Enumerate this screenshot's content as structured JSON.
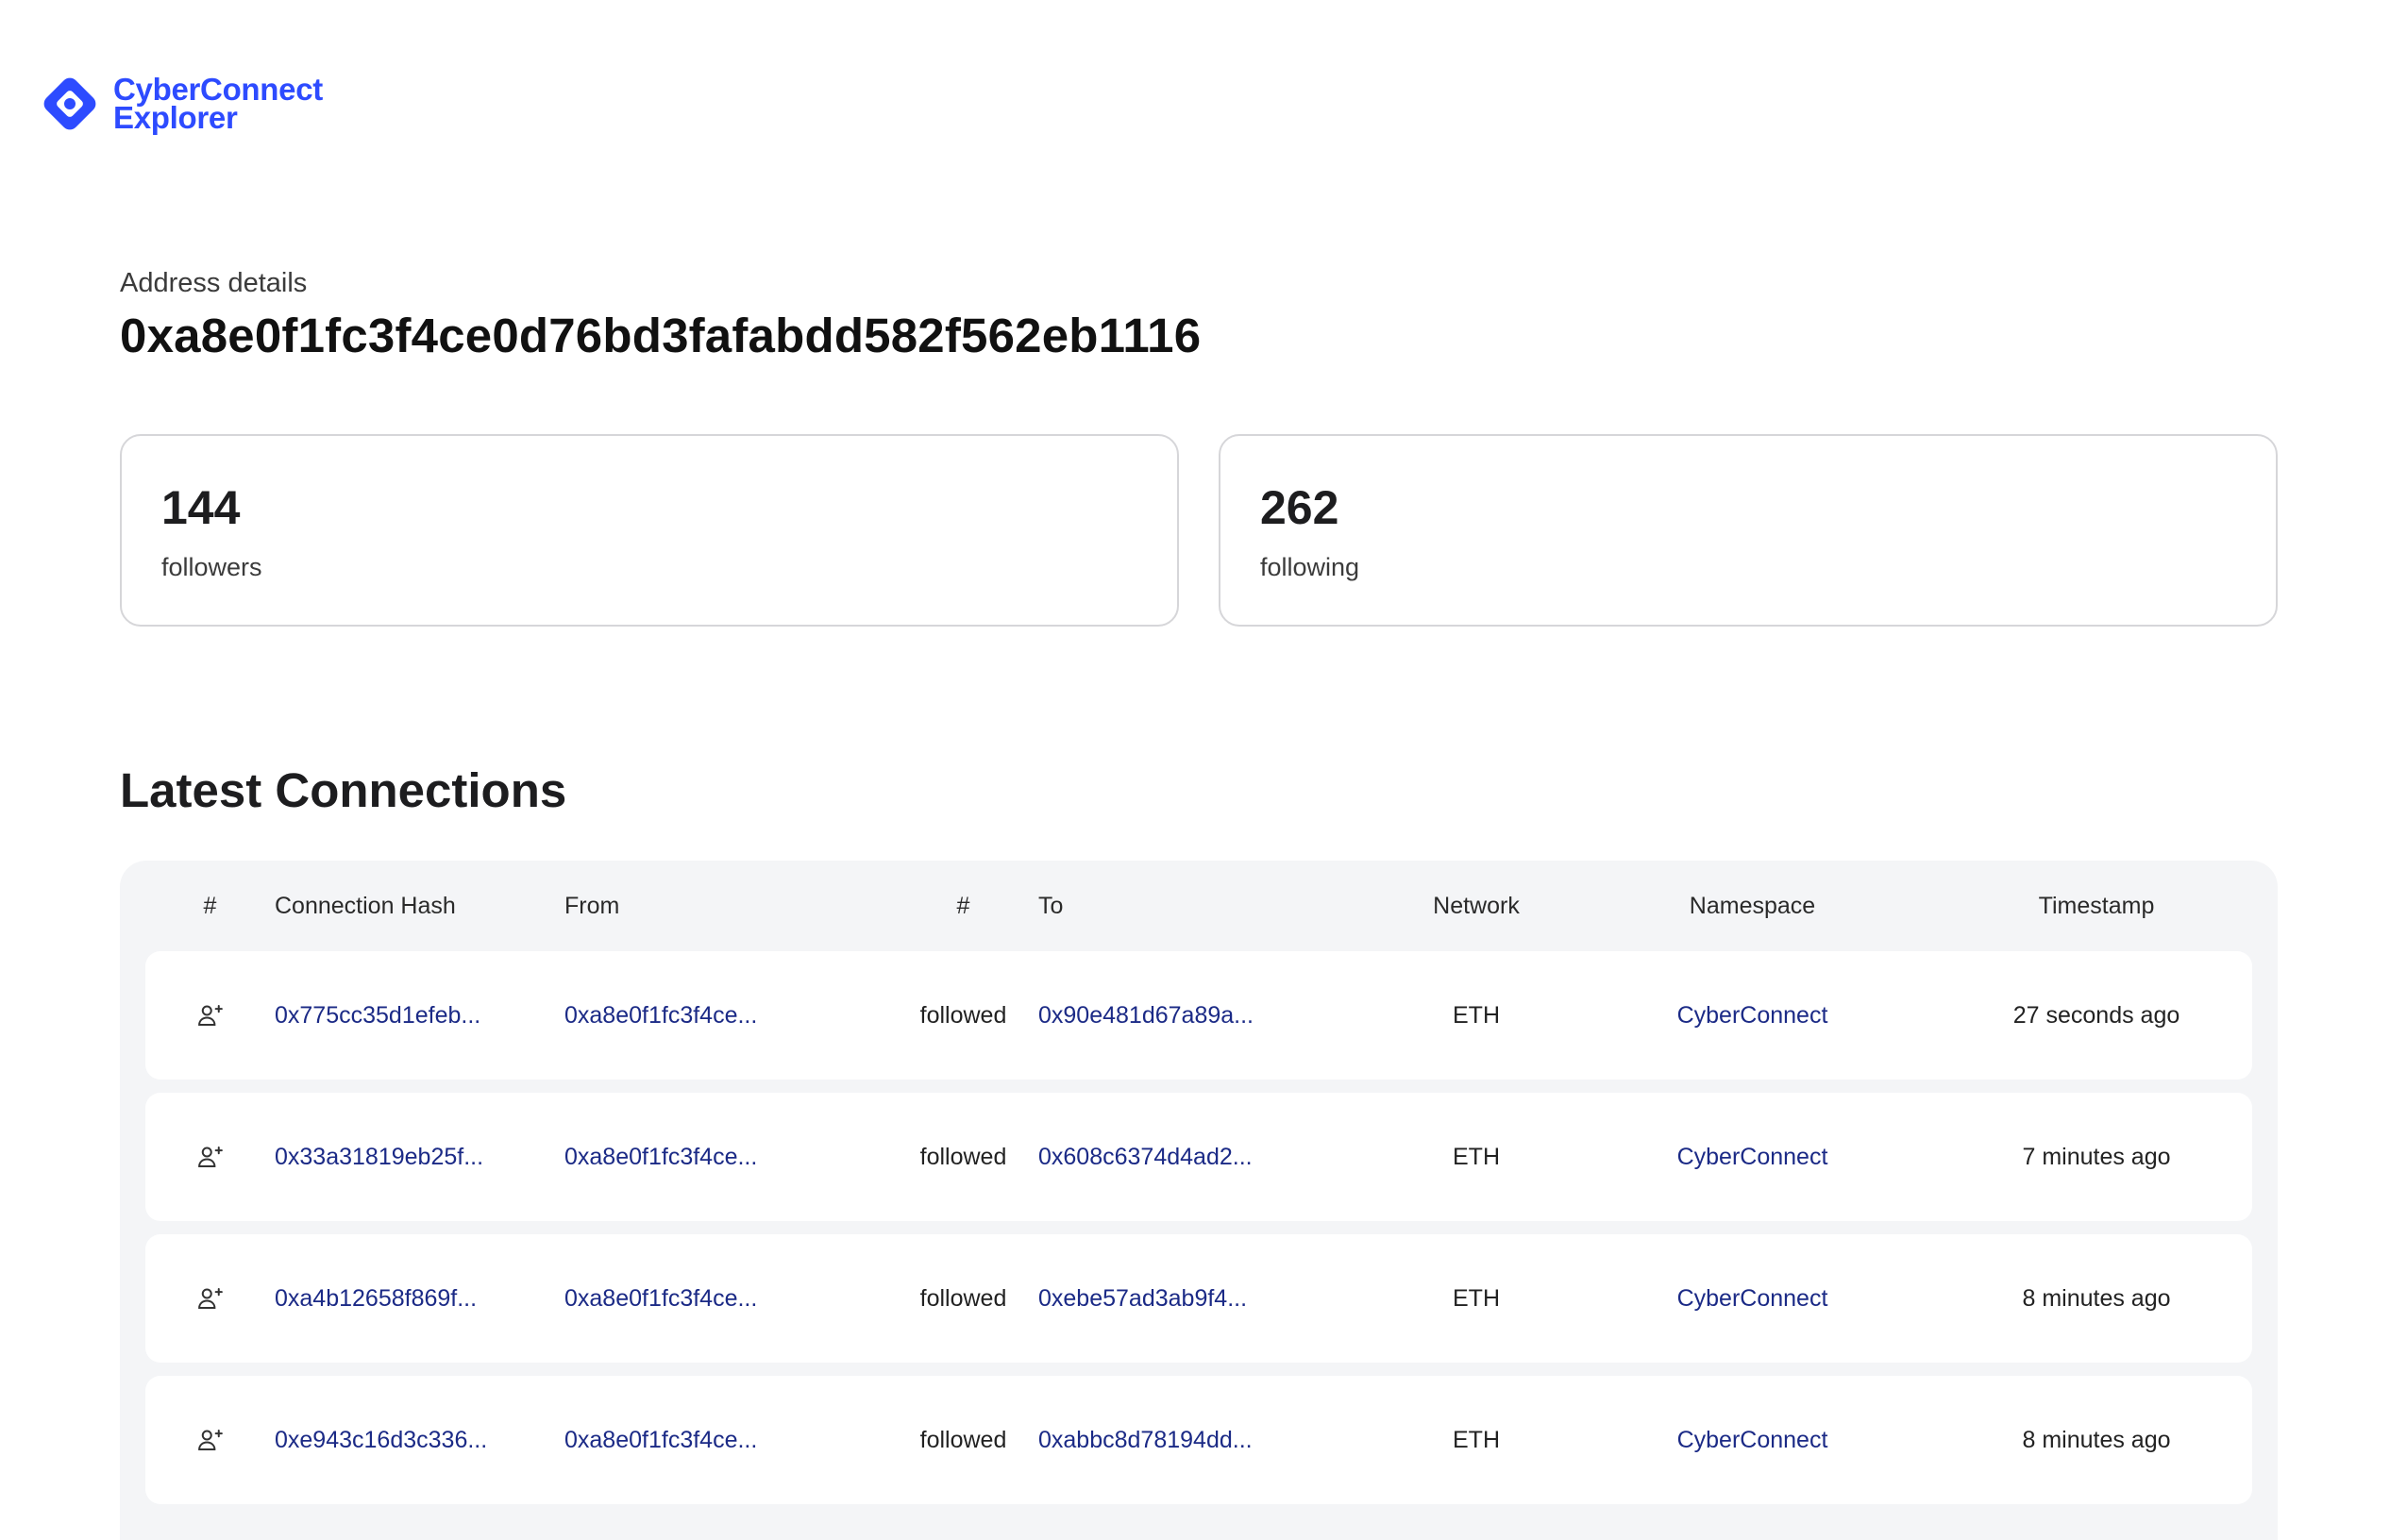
{
  "brand": {
    "line1": "CyberConnect",
    "line2": "Explorer",
    "color": "#2d4bff",
    "icon": "cyberconnect-logo-icon"
  },
  "address": {
    "label": "Address details",
    "value": "0xa8e0f1fc3f4ce0d76bd3fafabdd582f562eb1116"
  },
  "stats": {
    "followers": {
      "count": "144",
      "label": "followers"
    },
    "following": {
      "count": "262",
      "label": "following"
    }
  },
  "connections": {
    "title": "Latest Connections",
    "headers": [
      "#",
      "Connection Hash",
      "From",
      "#",
      "To",
      "Network",
      "Namespace",
      "Timestamp"
    ],
    "row_icon": "user-plus-icon",
    "rows": [
      {
        "hash": "0x775cc35d1efeb...",
        "from": "0xa8e0f1fc3f4ce...",
        "action": "followed",
        "to": "0x90e481d67a89a...",
        "network": "ETH",
        "namespace": "CyberConnect",
        "timestamp": "27 seconds ago"
      },
      {
        "hash": "0x33a31819eb25f...",
        "from": "0xa8e0f1fc3f4ce...",
        "action": "followed",
        "to": "0x608c6374d4ad2...",
        "network": "ETH",
        "namespace": "CyberConnect",
        "timestamp": "7 minutes ago"
      },
      {
        "hash": "0xa4b12658f869f...",
        "from": "0xa8e0f1fc3f4ce...",
        "action": "followed",
        "to": "0xebe57ad3ab9f4...",
        "network": "ETH",
        "namespace": "CyberConnect",
        "timestamp": "8 minutes ago"
      },
      {
        "hash": "0xe943c16d3c336...",
        "from": "0xa8e0f1fc3f4ce...",
        "action": "followed",
        "to": "0xabbc8d78194dd...",
        "network": "ETH",
        "namespace": "CyberConnect",
        "timestamp": "8 minutes ago"
      }
    ]
  }
}
